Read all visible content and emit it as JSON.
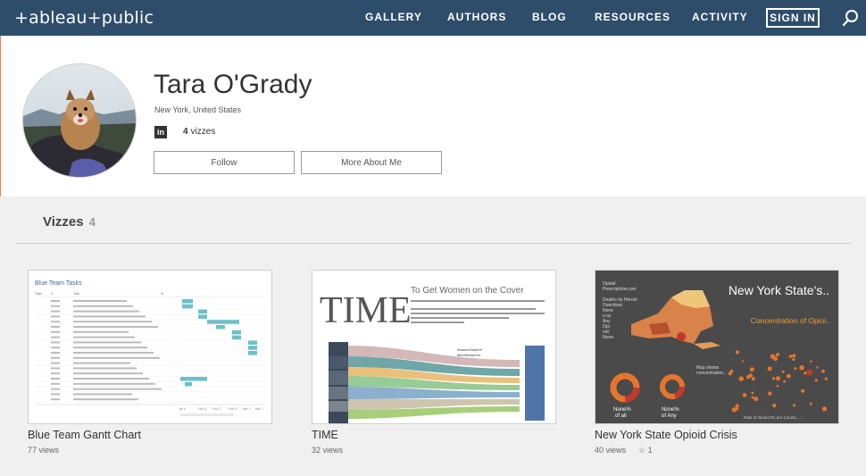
{
  "nav": {
    "logo": "+ableau+public",
    "links": [
      "GALLERY",
      "AUTHORS",
      "BLOG",
      "RESOURCES",
      "ACTIVITY"
    ],
    "signin": "SIGN IN"
  },
  "profile": {
    "name": "Tara O'Grady",
    "location": "New York, United States",
    "viz_count": "4",
    "viz_label": "vizzes",
    "follow": "Follow",
    "more": "More About Me"
  },
  "section": {
    "title": "Vizzes",
    "count": "4"
  },
  "cards": [
    {
      "title": "Blue Team Gantt Chart",
      "views": "77 views",
      "thumb_title": "Blue Team Tasks"
    },
    {
      "title": "TIME",
      "views": "32 views",
      "thumb_title": "TIME",
      "thumb_heading": "To Get Women on the Cover"
    },
    {
      "title": "New York State Opioid Crisis",
      "views": "40 views",
      "favorites": "1",
      "thumb_title": "New York State's..",
      "thumb_sub": "Concentration of Opioi.."
    }
  ],
  "colors": {
    "nav_bg": "#2e4d6b",
    "accent_orange": "#e5824c",
    "gantt_teal": "#6cc0c8"
  }
}
